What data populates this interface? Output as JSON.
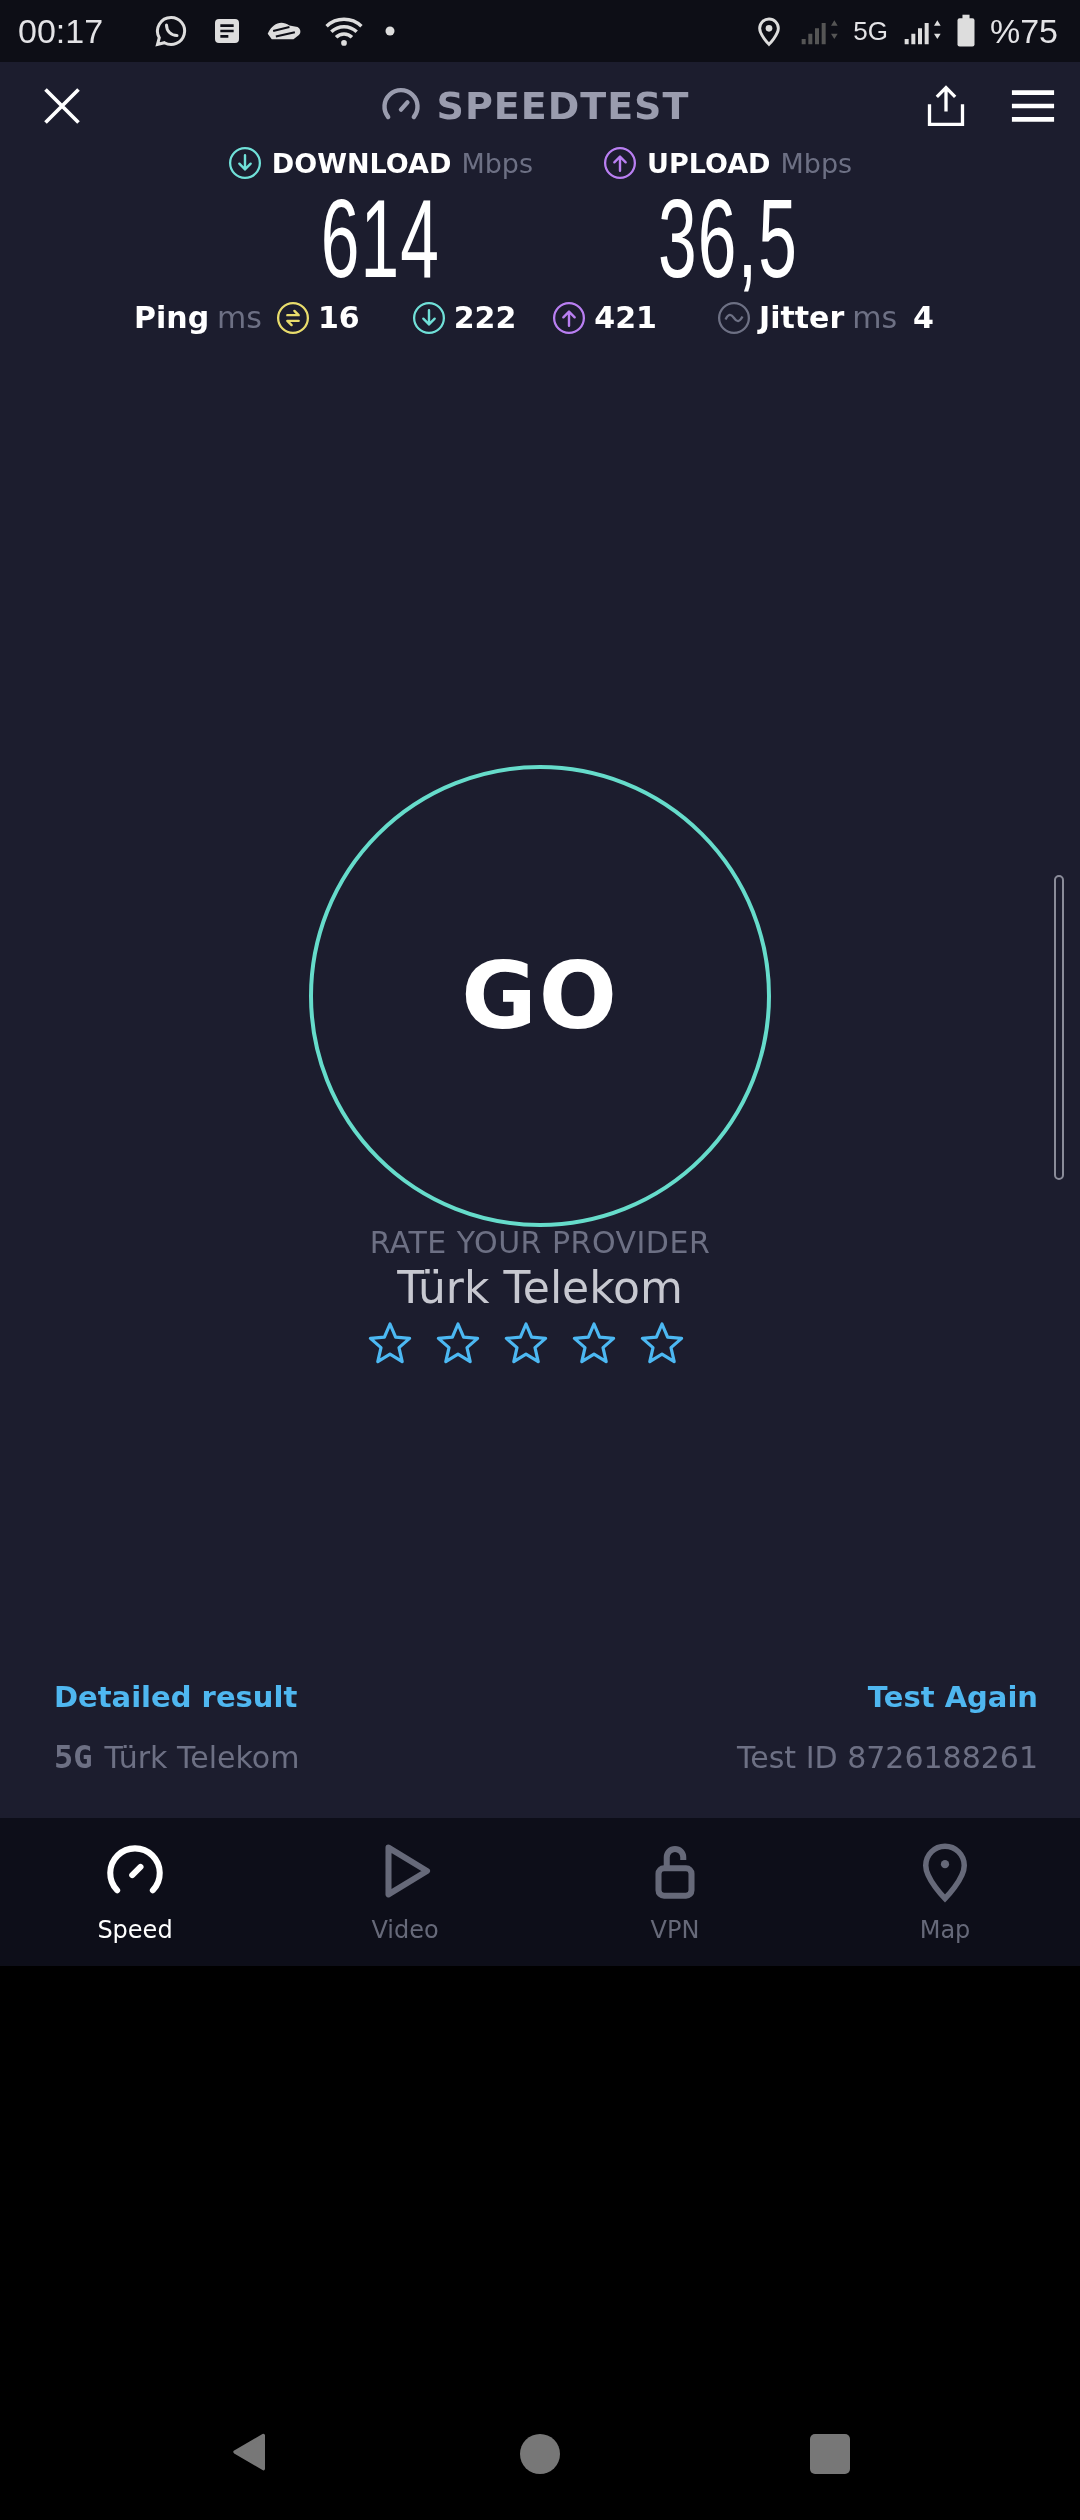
{
  "status_bar": {
    "time": "00:17",
    "network": "5G",
    "battery": "%75"
  },
  "header": {
    "title": "SPEEDTEST"
  },
  "results": [
    {
      "kind": "download",
      "label": "DOWNLOAD",
      "unit": "Mbps",
      "value": "614"
    },
    {
      "kind": "upload",
      "label": "UPLOAD",
      "unit": "Mbps",
      "value": "36,5"
    }
  ],
  "ping": {
    "label": "Ping",
    "unit": "ms",
    "values": [
      {
        "kind": "idle",
        "value": "16"
      },
      {
        "kind": "download",
        "value": "222"
      },
      {
        "kind": "upload",
        "value": "421"
      }
    ]
  },
  "jitter": {
    "label": "Jitter",
    "unit": "ms",
    "value": "4"
  },
  "go_button": {
    "label": "GO"
  },
  "rating": {
    "prompt": "RATE YOUR PROVIDER",
    "provider": "Türk Telekom",
    "stars": 0
  },
  "links": [
    {
      "label": "Detailed result"
    },
    {
      "label": "Test Again"
    }
  ],
  "connection": {
    "network": "5G",
    "provider": "Türk Telekom",
    "test_id": "Test ID 8726188261"
  },
  "tabs": [
    {
      "kind": "speed",
      "label": "Speed",
      "selected": true
    },
    {
      "kind": "video",
      "label": "Video",
      "selected": false
    },
    {
      "kind": "vpn",
      "label": "VPN",
      "selected": false
    },
    {
      "kind": "map",
      "label": "Map",
      "selected": false
    }
  ]
}
